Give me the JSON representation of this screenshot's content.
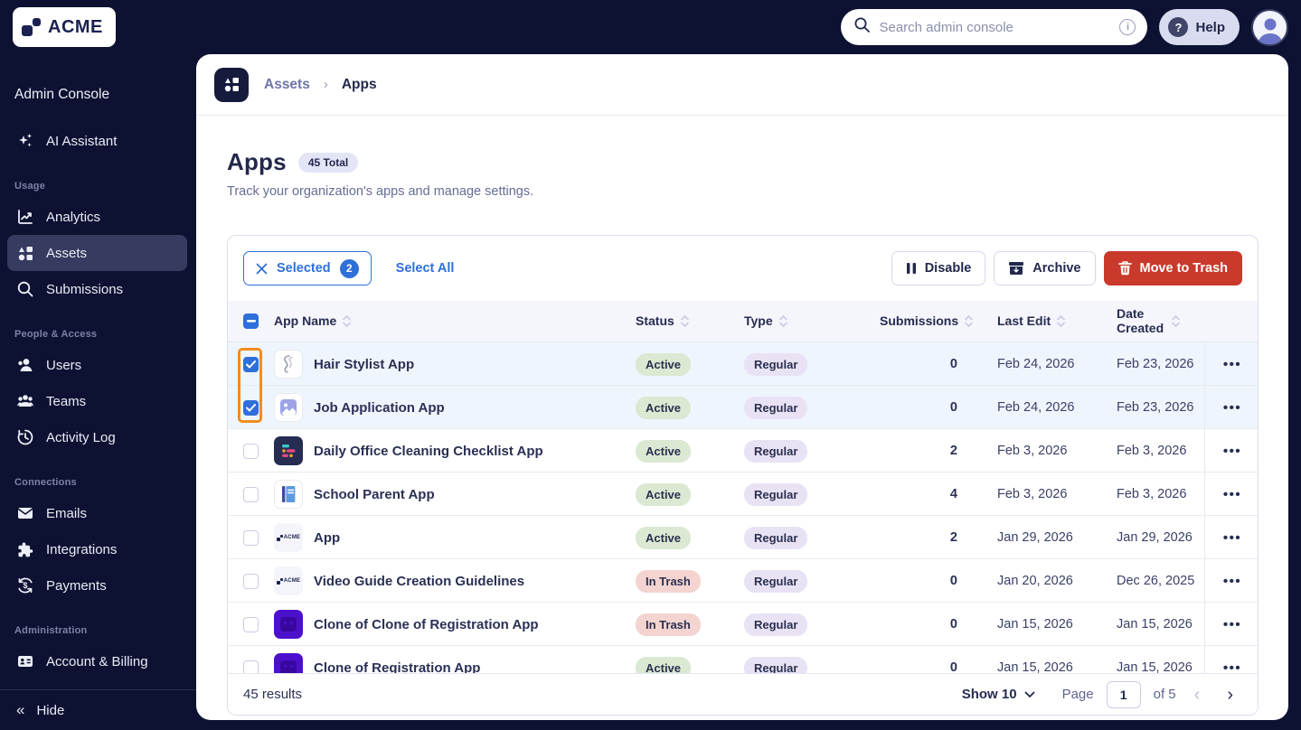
{
  "brand": {
    "name": "ACME"
  },
  "topbar": {
    "search_placeholder": "Search admin console",
    "help_label": "Help",
    "icons": [
      "search-icon",
      "info-icon",
      "help-question-icon",
      "avatar"
    ]
  },
  "sidebar": {
    "console_title": "Admin Console",
    "assistant_label": "AI Assistant",
    "sections": [
      {
        "label": "Usage"
      },
      {
        "label": "People & Access"
      },
      {
        "label": "Connections"
      },
      {
        "label": "Administration"
      }
    ],
    "items": {
      "analytics": "Analytics",
      "assets": "Assets",
      "submissions": "Submissions",
      "users": "Users",
      "teams": "Teams",
      "activity_log": "Activity Log",
      "emails": "Emails",
      "integrations": "Integrations",
      "payments": "Payments",
      "account_billing": "Account & Billing"
    },
    "active_item": "Assets",
    "hide_label": "Hide"
  },
  "breadcrumb": {
    "root": "Assets",
    "chevron": "›",
    "current": "Apps",
    "icon": "assets-icon"
  },
  "page": {
    "title": "Apps",
    "total_badge": "45 Total",
    "subtitle": "Track your organization's apps and manage settings."
  },
  "toolbar": {
    "selected_label": "Selected",
    "selected_count": "2",
    "select_all_label": "Select All",
    "disable_label": "Disable",
    "archive_label": "Archive",
    "trash_label": "Move to Trash"
  },
  "table": {
    "columns": [
      "App Name",
      "Status",
      "Type",
      "Submissions",
      "Last Edit",
      "Date Created"
    ],
    "rows": [
      {
        "name": "Hair Stylist App",
        "status": "Active",
        "status_class": "active",
        "type": "Regular",
        "submissions": "0",
        "last_edit": "Feb 24, 2026",
        "date_created": "Feb 23, 2026",
        "selected": true,
        "icon": "hair"
      },
      {
        "name": "Job Application App",
        "status": "Active",
        "status_class": "active",
        "type": "Regular",
        "submissions": "0",
        "last_edit": "Feb 24, 2026",
        "date_created": "Feb 23, 2026",
        "selected": true,
        "icon": "image"
      },
      {
        "name": "Daily Office Cleaning Checklist App",
        "status": "Active",
        "status_class": "active",
        "type": "Regular",
        "submissions": "2",
        "last_edit": "Feb 3, 2026",
        "date_created": "Feb 3, 2026",
        "selected": false,
        "icon": "checklist"
      },
      {
        "name": "School Parent App",
        "status": "Active",
        "status_class": "active",
        "type": "Regular",
        "submissions": "4",
        "last_edit": "Feb 3, 2026",
        "date_created": "Feb 3, 2026",
        "selected": false,
        "icon": "book"
      },
      {
        "name": "App",
        "status": "Active",
        "status_class": "active",
        "type": "Regular",
        "submissions": "2",
        "last_edit": "Jan 29, 2026",
        "date_created": "Jan 29, 2026",
        "selected": false,
        "icon": "acme"
      },
      {
        "name": "Video Guide Creation Guidelines",
        "status": "In Trash",
        "status_class": "trash",
        "type": "Regular",
        "submissions": "0",
        "last_edit": "Jan 20, 2026",
        "date_created": "Dec 26, 2025",
        "selected": false,
        "icon": "acme"
      },
      {
        "name": "Clone of Clone of Registration App",
        "status": "In Trash",
        "status_class": "trash",
        "type": "Regular",
        "submissions": "0",
        "last_edit": "Jan 15, 2026",
        "date_created": "Jan 15, 2026",
        "selected": false,
        "icon": "robot"
      },
      {
        "name": "Clone of Registration App",
        "status": "Active",
        "status_class": "active",
        "type": "Regular",
        "submissions": "0",
        "last_edit": "Jan 15, 2026",
        "date_created": "Jan 15, 2026",
        "selected": false,
        "icon": "robot"
      }
    ]
  },
  "footer": {
    "results": "45 results",
    "show_label": "Show 10",
    "page_label": "Page",
    "page_value": "1",
    "of_label": "of 5",
    "prev": "‹",
    "next": "›"
  },
  "colors": {
    "navy_bg": "#0D1232",
    "accent_blue": "#2F6FD9",
    "danger_red": "#C9392C",
    "highlight_orange": "#F18D1E",
    "active_badge_bg": "#DBE8D2",
    "trash_badge_bg": "#F4D4D0",
    "regular_badge_bg": "#E9E2F5",
    "selected_row_bg": "#EFF5FC"
  }
}
